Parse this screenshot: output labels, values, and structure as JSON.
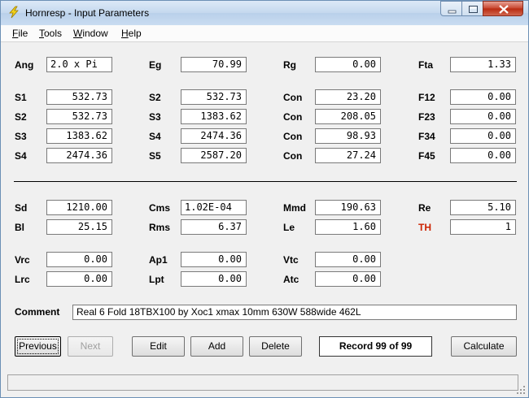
{
  "window": {
    "title": "Hornresp - Input Parameters"
  },
  "menu": [
    "File",
    "Tools",
    "Window",
    "Help"
  ],
  "top": [
    {
      "label": "Ang",
      "value": "2.0 x Pi"
    },
    {
      "label": "Eg",
      "value": "70.99"
    },
    {
      "label": "Rg",
      "value": "0.00"
    },
    {
      "label": "Fta",
      "value": "1.33"
    }
  ],
  "segments": [
    [
      {
        "label": "S1",
        "value": "532.73"
      },
      {
        "label": "S2",
        "value": "532.73"
      },
      {
        "label": "Con",
        "value": "23.20"
      },
      {
        "label": "F12",
        "value": "0.00"
      }
    ],
    [
      {
        "label": "S2",
        "value": "532.73"
      },
      {
        "label": "S3",
        "value": "1383.62"
      },
      {
        "label": "Con",
        "value": "208.05"
      },
      {
        "label": "F23",
        "value": "0.00"
      }
    ],
    [
      {
        "label": "S3",
        "value": "1383.62"
      },
      {
        "label": "S4",
        "value": "2474.36"
      },
      {
        "label": "Con",
        "value": "98.93"
      },
      {
        "label": "F34",
        "value": "0.00"
      }
    ],
    [
      {
        "label": "S4",
        "value": "2474.36"
      },
      {
        "label": "S5",
        "value": "2587.20"
      },
      {
        "label": "Con",
        "value": "27.24"
      },
      {
        "label": "F45",
        "value": "0.00"
      }
    ]
  ],
  "driver": [
    [
      {
        "label": "Sd",
        "value": "1210.00"
      },
      {
        "label": "Cms",
        "value": "1.02E-04"
      },
      {
        "label": "Mmd",
        "value": "190.63"
      },
      {
        "label": "Re",
        "value": "5.10"
      }
    ],
    [
      {
        "label": "Bl",
        "value": "25.15"
      },
      {
        "label": "Rms",
        "value": "6.37"
      },
      {
        "label": "Le",
        "value": "1.60"
      },
      {
        "label": "TH",
        "value": "1"
      }
    ]
  ],
  "chambers": [
    [
      {
        "label": "Vrc",
        "value": "0.00"
      },
      {
        "label": "Ap1",
        "value": "0.00"
      },
      {
        "label": "Vtc",
        "value": "0.00"
      }
    ],
    [
      {
        "label": "Lrc",
        "value": "0.00"
      },
      {
        "label": "Lpt",
        "value": "0.00"
      },
      {
        "label": "Atc",
        "value": "0.00"
      }
    ]
  ],
  "comment": {
    "label": "Comment",
    "value": "Real 6 Fold 18TBX100 by Xoc1 xmax 10mm 630W 588wide 462L"
  },
  "buttons": {
    "previous": "Previous",
    "next": "Next",
    "edit": "Edit",
    "add": "Add",
    "delete": "Delete",
    "calculate": "Calculate"
  },
  "record": "Record 99 of 99",
  "colors": {
    "th_label": "#cc2200",
    "titlebar": "#c4d8ee",
    "close_button": "#c7442d"
  }
}
